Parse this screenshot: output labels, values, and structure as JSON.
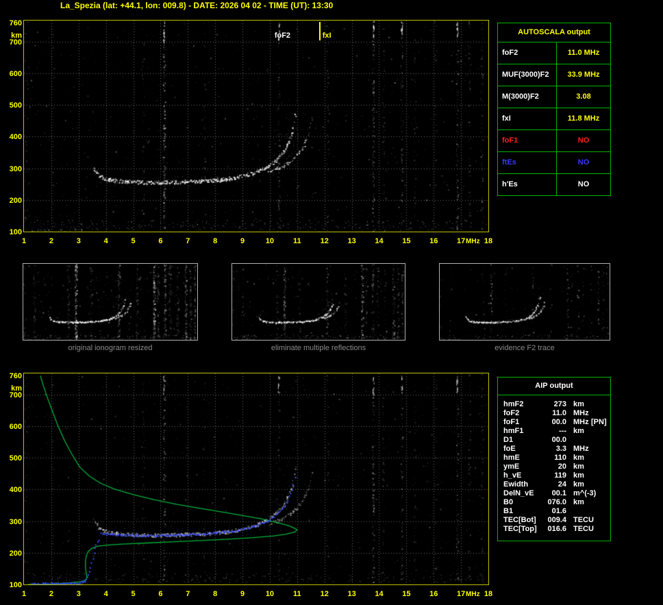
{
  "window": {
    "title": "La_Spezia (lat: +44.1, lon: 009.8) - DATE: 2026 04 02 - TIME (UT): 13:30"
  },
  "colors": {
    "background": "#000000",
    "title_text": "#ffff00",
    "plot_border": "#c0c000",
    "axis_text": "#ffff00",
    "grid": "#969696",
    "echo_top": "#ffffff",
    "echo_bottom": "#d2d2d2",
    "table_border": "#00b400",
    "table_text": "#ffffff",
    "value_text": "#ffff00",
    "no_red": "#ff2020",
    "no_blue": "#3838ff",
    "profile_green": "#00b43c",
    "trace_blue": "#3c50ff",
    "thumb_border": "#b0b0b0",
    "caption_text": "#8a8a8a",
    "fxi_line": "#ffff00"
  },
  "autoscala_table": {
    "header": "AUTOSCALA output",
    "rows": [
      {
        "label": "foF2",
        "value": "11.0 MHz",
        "label_color": "#ffffff",
        "value_color": "#ffff00"
      },
      {
        "label": "MUF(3000)F2",
        "value": "33.9 MHz",
        "label_color": "#ffffff",
        "value_color": "#ffff00"
      },
      {
        "label": "M(3000)F2",
        "value": "3.08",
        "label_color": "#ffffff",
        "value_color": "#ffff00"
      },
      {
        "label": "fxI",
        "value": "11.8 MHz",
        "label_color": "#ffffff",
        "value_color": "#ffff00"
      },
      {
        "label": "foF1",
        "value": "NO",
        "label_color": "#ff2020",
        "value_color": "#ff2020"
      },
      {
        "label": "ftEs",
        "value": "NO",
        "label_color": "#3838ff",
        "value_color": "#3838ff"
      },
      {
        "label": "h'Es",
        "value": "NO",
        "label_color": "#ffffff",
        "value_color": "#ffffff"
      }
    ]
  },
  "aip_table": {
    "header": "AIP output",
    "rows": [
      {
        "name": "hmF2",
        "value": "273",
        "unit": "km",
        "note": ""
      },
      {
        "name": "foF2",
        "value": "11.0",
        "unit": "MHz",
        "note": ""
      },
      {
        "name": "foF1",
        "value": "00.0",
        "unit": "MHz",
        "note": "[PN]"
      },
      {
        "name": "hmF1",
        "value": "---",
        "unit": "km",
        "note": ""
      },
      {
        "name": "D1",
        "value": "00.0",
        "unit": "",
        "note": ""
      },
      {
        "name": "foE",
        "value": "3.3",
        "unit": "MHz",
        "note": ""
      },
      {
        "name": "hmE",
        "value": "110",
        "unit": "km",
        "note": ""
      },
      {
        "name": "ymE",
        "value": "20",
        "unit": "km",
        "note": ""
      },
      {
        "name": "h_vE",
        "value": "119",
        "unit": "km",
        "note": ""
      },
      {
        "name": "Ewidth",
        "value": "24",
        "unit": "km",
        "note": ""
      },
      {
        "name": "DelN_vE",
        "value": "00.1",
        "unit": "m^(-3)",
        "note": ""
      },
      {
        "name": "B0",
        "value": "076.0",
        "unit": "km",
        "note": ""
      },
      {
        "name": "B1",
        "value": "01.6",
        "unit": "",
        "note": ""
      },
      {
        "name": "TEC[Bot]",
        "value": "009.4",
        "unit": "TECU",
        "note": ""
      },
      {
        "name": "TEC[Top]",
        "value": "016.6",
        "unit": "TECU",
        "note": ""
      }
    ]
  },
  "thumbnails": [
    {
      "caption": "original ionogram resized"
    },
    {
      "caption": "eliminate multiple reflections"
    },
    {
      "caption": "evidence F2 trace"
    }
  ],
  "chart_data": {
    "type": "scatter",
    "description": "Ionogram (echo virtual height vs sounding frequency) with autoscaled traces and electron density profile",
    "x_axis": {
      "label": "MHz",
      "min": 1,
      "max": 18,
      "ticks": [
        1,
        2,
        3,
        4,
        5,
        6,
        7,
        8,
        9,
        10,
        11,
        12,
        13,
        14,
        15,
        16,
        17,
        18
      ]
    },
    "y_axis": {
      "label": "km",
      "min": 100,
      "max": 767,
      "ticks": [
        760,
        700,
        600,
        500,
        400,
        300,
        200,
        100
      ]
    },
    "grid": true,
    "annotations": {
      "foF2_label": "foF2",
      "foF2_mhz": 11.0,
      "fxI_label": "fxI",
      "fxI_mhz": 11.8
    },
    "series": {
      "f2_ordinary_trace": [
        [
          3.55,
          303
        ],
        [
          3.7,
          283
        ],
        [
          3.9,
          270
        ],
        [
          4.2,
          263
        ],
        [
          4.7,
          259
        ],
        [
          5.4,
          257
        ],
        [
          6.2,
          257
        ],
        [
          7.0,
          259
        ],
        [
          7.8,
          262
        ],
        [
          8.4,
          267
        ],
        [
          8.95,
          275
        ],
        [
          9.35,
          285
        ],
        [
          9.7,
          297
        ],
        [
          10.0,
          312
        ],
        [
          10.25,
          330
        ],
        [
          10.45,
          350
        ],
        [
          10.62,
          373
        ],
        [
          10.75,
          399
        ],
        [
          10.85,
          427
        ],
        [
          10.91,
          455
        ],
        [
          10.95,
          483
        ]
      ],
      "f2_extraordinary_trace": [
        [
          9.95,
          292
        ],
        [
          10.2,
          299
        ],
        [
          10.5,
          311
        ],
        [
          10.8,
          328
        ],
        [
          11.05,
          349
        ],
        [
          11.25,
          374
        ],
        [
          11.38,
          401
        ],
        [
          11.47,
          430
        ],
        [
          11.53,
          460
        ]
      ],
      "e_trace": [
        [
          1.25,
          104
        ],
        [
          1.8,
          104
        ],
        [
          2.35,
          105
        ],
        [
          2.8,
          105
        ],
        [
          3.15,
          106
        ]
      ],
      "rfi_bands_mhz": [
        {
          "f": 2.05,
          "strength": 0.25
        },
        {
          "f": 5.35,
          "strength": 0.3
        },
        {
          "f": 6.12,
          "strength": 0.95
        },
        {
          "f": 7.6,
          "strength": 0.25
        },
        {
          "f": 10.32,
          "strength": 0.5
        },
        {
          "f": 12.1,
          "strength": 0.3
        },
        {
          "f": 13.78,
          "strength": 0.9
        },
        {
          "f": 14.15,
          "strength": 0.35
        },
        {
          "f": 14.82,
          "strength": 0.6
        },
        {
          "f": 15.3,
          "strength": 0.3
        },
        {
          "f": 16.05,
          "strength": 0.25
        },
        {
          "f": 16.85,
          "strength": 0.65
        },
        {
          "f": 17.3,
          "strength": 0.4
        },
        {
          "f": 17.75,
          "strength": 0.45
        }
      ],
      "profile_green": [
        [
          1.6,
          760
        ],
        [
          1.72,
          725
        ],
        [
          1.88,
          685
        ],
        [
          2.05,
          645
        ],
        [
          2.25,
          600
        ],
        [
          2.5,
          552
        ],
        [
          2.75,
          512
        ],
        [
          3.05,
          470
        ],
        [
          3.4,
          442
        ],
        [
          3.8,
          420
        ],
        [
          4.3,
          402
        ],
        [
          5.0,
          384
        ],
        [
          5.8,
          367
        ],
        [
          6.6,
          353
        ],
        [
          7.4,
          341
        ],
        [
          8.2,
          330
        ],
        [
          9.0,
          318
        ],
        [
          9.7,
          307
        ],
        [
          10.2,
          297
        ],
        [
          10.6,
          288
        ],
        [
          10.85,
          280
        ],
        [
          11.0,
          273
        ],
        [
          10.92,
          266
        ],
        [
          10.6,
          259
        ],
        [
          10.1,
          253
        ],
        [
          9.4,
          248
        ],
        [
          8.5,
          243
        ],
        [
          7.5,
          239
        ],
        [
          6.5,
          235
        ],
        [
          5.5,
          231
        ],
        [
          4.7,
          228
        ],
        [
          4.1,
          225
        ],
        [
          3.7,
          221
        ],
        [
          3.48,
          214
        ],
        [
          3.35,
          204
        ],
        [
          3.28,
          190
        ],
        [
          3.25,
          172
        ],
        [
          3.25,
          152
        ],
        [
          3.28,
          136
        ],
        [
          3.3,
          124
        ],
        [
          3.28,
          115
        ],
        [
          3.1,
          109
        ],
        [
          2.7,
          105
        ],
        [
          2.2,
          102
        ],
        [
          1.6,
          100
        ],
        [
          1.15,
          100
        ]
      ],
      "restored_trace_blue": [
        [
          3.8,
          261
        ],
        [
          4.3,
          258
        ],
        [
          5.0,
          256
        ],
        [
          5.8,
          256
        ],
        [
          6.6,
          258
        ],
        [
          7.4,
          261
        ],
        [
          8.1,
          265
        ],
        [
          8.7,
          271
        ],
        [
          9.2,
          280
        ],
        [
          9.6,
          291
        ],
        [
          9.95,
          305
        ],
        [
          10.25,
          323
        ],
        [
          10.48,
          344
        ],
        [
          10.65,
          368
        ],
        [
          10.78,
          396
        ],
        [
          10.87,
          425
        ],
        [
          10.92,
          452
        ],
        [
          10.95,
          470
        ]
      ],
      "restored_e_trace_blue": [
        [
          1.3,
          103
        ],
        [
          1.75,
          104
        ],
        [
          2.2,
          104
        ],
        [
          2.65,
          105
        ],
        [
          3.0,
          106
        ],
        [
          3.18,
          110
        ],
        [
          3.3,
          122
        ],
        [
          3.38,
          141
        ],
        [
          3.45,
          166
        ],
        [
          3.52,
          194
        ],
        [
          3.6,
          222
        ],
        [
          3.72,
          246
        ]
      ]
    }
  }
}
